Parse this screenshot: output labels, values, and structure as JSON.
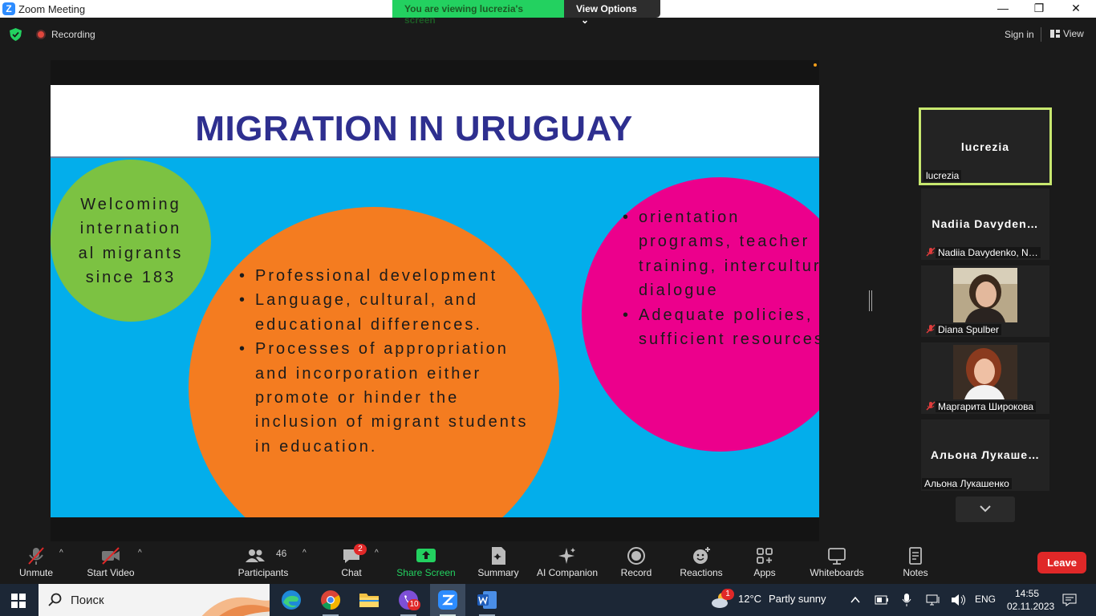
{
  "window": {
    "title": "Zoom Meeting",
    "minimize": "—",
    "maximize": "❐",
    "close": "✕"
  },
  "banner": {
    "message": "You are viewing lucrezia's screen",
    "options_label": "View Options",
    "options_caret": "⌄"
  },
  "topbar": {
    "recording_label": "Recording",
    "signin_label": "Sign in",
    "view_label": "View"
  },
  "slide": {
    "title": "MIGRATION IN URUGUAY",
    "green_lines": [
      "Welcoming",
      "internation",
      "al migrants",
      "since 183"
    ],
    "orange_bullets": [
      "Professional development",
      "Language, cultural, and educational differences.",
      "Processes of appropriation and incorporation either promote or hinder the inclusion of migrant students in education."
    ],
    "pink_bullets": [
      "orientation programs, teacher training, intercultural dialogue",
      "Adequate policies, sufficient resources."
    ]
  },
  "participants": [
    {
      "big": "lucrezia",
      "label": "lucrezia",
      "muted": false
    },
    {
      "big": "Nadiia  Davyden…",
      "label": "Nadiia Davydenko, N…",
      "muted": true
    },
    {
      "big": "",
      "label": "Diana Spulber",
      "muted": true
    },
    {
      "big": "",
      "label": "Маргарита Широкова",
      "muted": true
    },
    {
      "big": "Альона  Лукаше…",
      "label": "Альона Лукашенко",
      "muted": false
    }
  ],
  "toolbar": {
    "unmute": "Unmute",
    "start_video": "Start Video",
    "participants": "Participants",
    "participants_count": "46",
    "chat": "Chat",
    "chat_badge": "2",
    "share_screen": "Share Screen",
    "summary": "Summary",
    "ai_companion": "AI Companion",
    "record": "Record",
    "reactions": "Reactions",
    "apps": "Apps",
    "whiteboards": "Whiteboards",
    "notes": "Notes",
    "leave": "Leave",
    "caret": "^"
  },
  "taskbar": {
    "search_placeholder": "Поиск",
    "viber_badge": "10",
    "weather_badge": "1",
    "weather_temp": "12°C",
    "weather_desc": "Partly sunny",
    "language": "ENG",
    "time": "14:55",
    "date": "02.11.2023"
  },
  "colors": {
    "slide_blue": "#03aeeb",
    "title_navy": "#2e2f8f",
    "green_circle": "#7cc242",
    "orange_circle": "#f47c20",
    "pink_circle": "#ec008c",
    "banner_green": "#23d160",
    "leave_red": "#e02828",
    "active_speaker": "#c8e86f",
    "share_green": "#23d160"
  }
}
